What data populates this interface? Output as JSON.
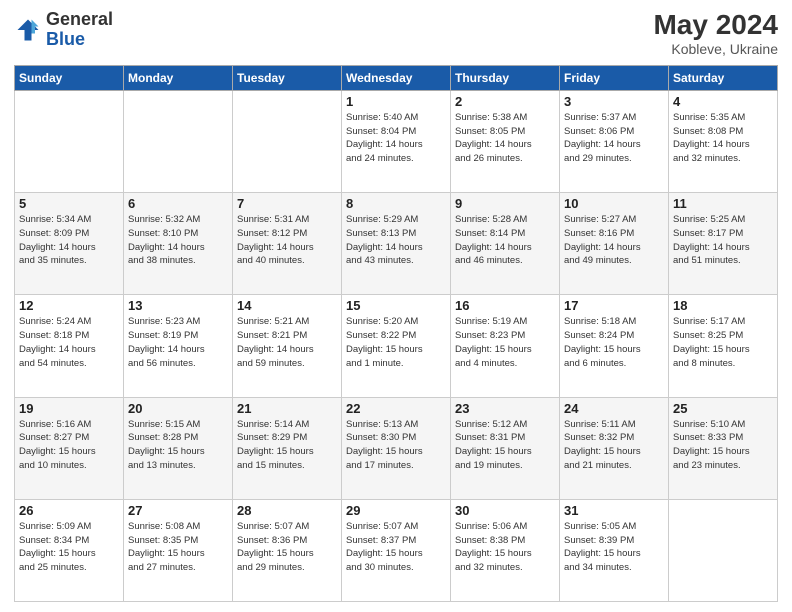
{
  "header": {
    "logo_general": "General",
    "logo_blue": "Blue",
    "month_title": "May 2024",
    "subtitle": "Kobleve, Ukraine"
  },
  "weekdays": [
    "Sunday",
    "Monday",
    "Tuesday",
    "Wednesday",
    "Thursday",
    "Friday",
    "Saturday"
  ],
  "weeks": [
    [
      {
        "day": "",
        "info": ""
      },
      {
        "day": "",
        "info": ""
      },
      {
        "day": "",
        "info": ""
      },
      {
        "day": "1",
        "info": "Sunrise: 5:40 AM\nSunset: 8:04 PM\nDaylight: 14 hours\nand 24 minutes."
      },
      {
        "day": "2",
        "info": "Sunrise: 5:38 AM\nSunset: 8:05 PM\nDaylight: 14 hours\nand 26 minutes."
      },
      {
        "day": "3",
        "info": "Sunrise: 5:37 AM\nSunset: 8:06 PM\nDaylight: 14 hours\nand 29 minutes."
      },
      {
        "day": "4",
        "info": "Sunrise: 5:35 AM\nSunset: 8:08 PM\nDaylight: 14 hours\nand 32 minutes."
      }
    ],
    [
      {
        "day": "5",
        "info": "Sunrise: 5:34 AM\nSunset: 8:09 PM\nDaylight: 14 hours\nand 35 minutes."
      },
      {
        "day": "6",
        "info": "Sunrise: 5:32 AM\nSunset: 8:10 PM\nDaylight: 14 hours\nand 38 minutes."
      },
      {
        "day": "7",
        "info": "Sunrise: 5:31 AM\nSunset: 8:12 PM\nDaylight: 14 hours\nand 40 minutes."
      },
      {
        "day": "8",
        "info": "Sunrise: 5:29 AM\nSunset: 8:13 PM\nDaylight: 14 hours\nand 43 minutes."
      },
      {
        "day": "9",
        "info": "Sunrise: 5:28 AM\nSunset: 8:14 PM\nDaylight: 14 hours\nand 46 minutes."
      },
      {
        "day": "10",
        "info": "Sunrise: 5:27 AM\nSunset: 8:16 PM\nDaylight: 14 hours\nand 49 minutes."
      },
      {
        "day": "11",
        "info": "Sunrise: 5:25 AM\nSunset: 8:17 PM\nDaylight: 14 hours\nand 51 minutes."
      }
    ],
    [
      {
        "day": "12",
        "info": "Sunrise: 5:24 AM\nSunset: 8:18 PM\nDaylight: 14 hours\nand 54 minutes."
      },
      {
        "day": "13",
        "info": "Sunrise: 5:23 AM\nSunset: 8:19 PM\nDaylight: 14 hours\nand 56 minutes."
      },
      {
        "day": "14",
        "info": "Sunrise: 5:21 AM\nSunset: 8:21 PM\nDaylight: 14 hours\nand 59 minutes."
      },
      {
        "day": "15",
        "info": "Sunrise: 5:20 AM\nSunset: 8:22 PM\nDaylight: 15 hours\nand 1 minute."
      },
      {
        "day": "16",
        "info": "Sunrise: 5:19 AM\nSunset: 8:23 PM\nDaylight: 15 hours\nand 4 minutes."
      },
      {
        "day": "17",
        "info": "Sunrise: 5:18 AM\nSunset: 8:24 PM\nDaylight: 15 hours\nand 6 minutes."
      },
      {
        "day": "18",
        "info": "Sunrise: 5:17 AM\nSunset: 8:25 PM\nDaylight: 15 hours\nand 8 minutes."
      }
    ],
    [
      {
        "day": "19",
        "info": "Sunrise: 5:16 AM\nSunset: 8:27 PM\nDaylight: 15 hours\nand 10 minutes."
      },
      {
        "day": "20",
        "info": "Sunrise: 5:15 AM\nSunset: 8:28 PM\nDaylight: 15 hours\nand 13 minutes."
      },
      {
        "day": "21",
        "info": "Sunrise: 5:14 AM\nSunset: 8:29 PM\nDaylight: 15 hours\nand 15 minutes."
      },
      {
        "day": "22",
        "info": "Sunrise: 5:13 AM\nSunset: 8:30 PM\nDaylight: 15 hours\nand 17 minutes."
      },
      {
        "day": "23",
        "info": "Sunrise: 5:12 AM\nSunset: 8:31 PM\nDaylight: 15 hours\nand 19 minutes."
      },
      {
        "day": "24",
        "info": "Sunrise: 5:11 AM\nSunset: 8:32 PM\nDaylight: 15 hours\nand 21 minutes."
      },
      {
        "day": "25",
        "info": "Sunrise: 5:10 AM\nSunset: 8:33 PM\nDaylight: 15 hours\nand 23 minutes."
      }
    ],
    [
      {
        "day": "26",
        "info": "Sunrise: 5:09 AM\nSunset: 8:34 PM\nDaylight: 15 hours\nand 25 minutes."
      },
      {
        "day": "27",
        "info": "Sunrise: 5:08 AM\nSunset: 8:35 PM\nDaylight: 15 hours\nand 27 minutes."
      },
      {
        "day": "28",
        "info": "Sunrise: 5:07 AM\nSunset: 8:36 PM\nDaylight: 15 hours\nand 29 minutes."
      },
      {
        "day": "29",
        "info": "Sunrise: 5:07 AM\nSunset: 8:37 PM\nDaylight: 15 hours\nand 30 minutes."
      },
      {
        "day": "30",
        "info": "Sunrise: 5:06 AM\nSunset: 8:38 PM\nDaylight: 15 hours\nand 32 minutes."
      },
      {
        "day": "31",
        "info": "Sunrise: 5:05 AM\nSunset: 8:39 PM\nDaylight: 15 hours\nand 34 minutes."
      },
      {
        "day": "",
        "info": ""
      }
    ]
  ]
}
